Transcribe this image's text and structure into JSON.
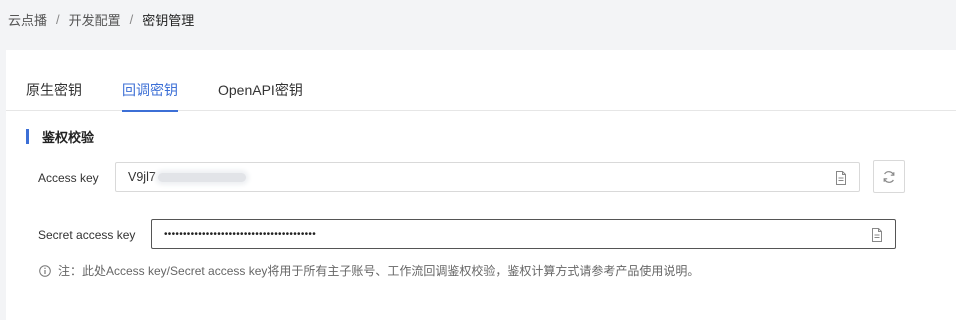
{
  "breadcrumb": {
    "items": [
      "云点播",
      "开发配置",
      "密钥管理"
    ],
    "separator": "/"
  },
  "tabs": [
    {
      "label": "原生密钥",
      "active": false
    },
    {
      "label": "回调密钥",
      "active": true
    },
    {
      "label": "OpenAPI密钥",
      "active": false
    }
  ],
  "section": {
    "title": "鉴权校验"
  },
  "access_key": {
    "label": "Access key",
    "value": "V9jl7"
  },
  "secret_access_key": {
    "label": "Secret access key",
    "value": "••••••••••••••••••••••••••••••••••••••••"
  },
  "note": "注：此处Access key/Secret access key将用于所有主子账号、工作流回调鉴权校验，鉴权计算方式请参考产品使用说明。",
  "icons": {
    "copy": "copy-icon",
    "refresh": "refresh-icon",
    "info": "info-icon"
  },
  "colors": {
    "accent": "#3c6fd6"
  }
}
